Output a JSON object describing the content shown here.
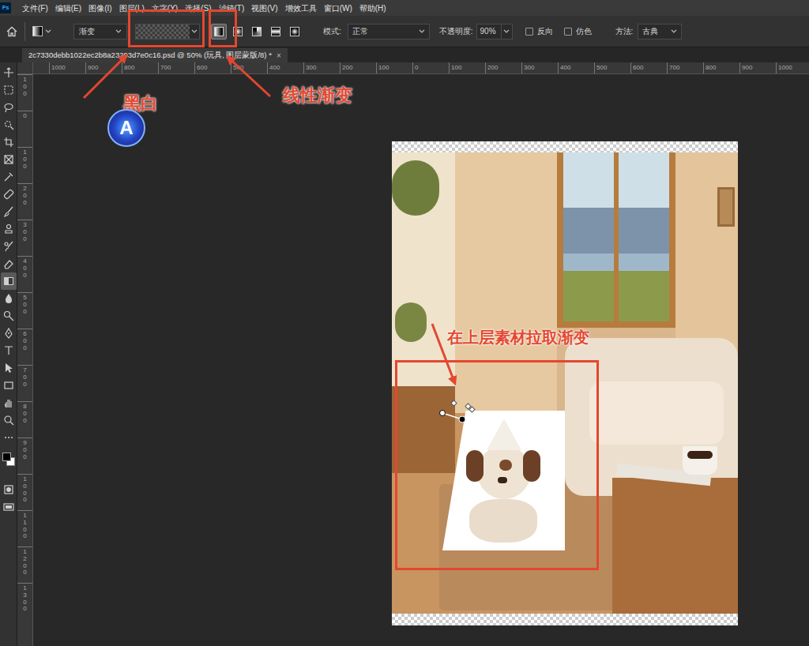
{
  "menu": {
    "logo": "Ps",
    "items": [
      "文件(F)",
      "编辑(E)",
      "图像(I)",
      "图层(L)",
      "文字(Y)",
      "选择(S)",
      "滤镜(T)",
      "视图(V)",
      "增效工具",
      "窗口(W)",
      "帮助(H)"
    ]
  },
  "options": {
    "preset": "渐变",
    "gradient_types": [
      {
        "selected": true
      },
      {
        "selected": false
      },
      {
        "selected": false
      },
      {
        "selected": false
      },
      {
        "selected": false
      }
    ],
    "mode_label": "模式:",
    "mode": "正常",
    "opacity_label": "不透明度:",
    "opacity": "90%",
    "checkboxes": [
      {
        "label": "反向",
        "checked": false
      },
      {
        "label": "仿色",
        "checked": false
      }
    ],
    "method_label": "方法:",
    "method": "古典"
  },
  "document_tab": {
    "title": "2c7330debb1022ec2b8a23293d7e0c16.psd @ 50% (玩具, 图层蒙版/8) *",
    "close": "×",
    "selected": true
  },
  "tools": [
    {
      "selected": false
    },
    {
      "selected": false
    },
    {
      "selected": false
    },
    {
      "selected": false
    },
    {
      "selected": false
    },
    {
      "selected": false
    },
    {
      "selected": false
    },
    {
      "selected": false
    },
    {
      "selected": false
    },
    {
      "selected": false
    },
    {
      "selected": false
    },
    {
      "selected": false
    },
    {
      "selected": true
    },
    {
      "selected": false
    },
    {
      "selected": false
    },
    {
      "selected": false
    },
    {
      "selected": false
    },
    {
      "selected": false
    },
    {
      "selected": false
    },
    {
      "selected": false
    },
    {
      "selected": false
    },
    {
      "selected": false
    },
    {
      "selected": false
    },
    {
      "selected": false
    }
  ],
  "rulers": {
    "horizontal": [
      "1000",
      "900",
      "800",
      "700",
      "600",
      "500",
      "400",
      "300",
      "200",
      "100",
      "0",
      "100",
      "200",
      "300",
      "400",
      "500",
      "600",
      "700",
      "800",
      "900",
      "1000"
    ],
    "vertical": [
      "100",
      "0",
      "100",
      "200",
      "300",
      "400",
      "500",
      "600",
      "700",
      "800",
      "900",
      "1000",
      "1100",
      "1200",
      "1300"
    ]
  },
  "annotations": [
    {
      "text": "黑白"
    },
    {
      "text": "线性渐变"
    },
    {
      "text": "在上层素材拉取渐变"
    }
  ],
  "watermark": {
    "text": "A"
  }
}
